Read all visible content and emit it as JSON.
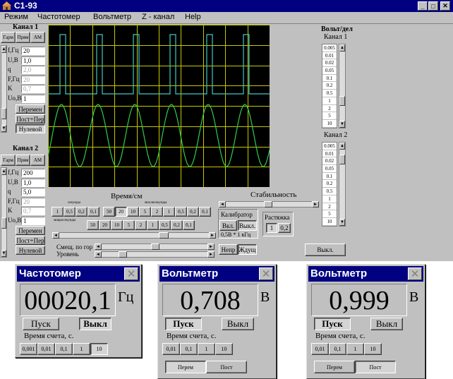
{
  "window": {
    "title": "С1-93"
  },
  "menu": [
    "Режим",
    "Частотомер",
    "Вольтметр",
    "Z - канал",
    "Help"
  ],
  "channel1": {
    "title": "Канал 1",
    "modes": [
      "Гарм",
      "Прям",
      "АМ"
    ],
    "rows": [
      {
        "label": "f,Гц",
        "value": "20",
        "dim": false
      },
      {
        "label": "U,B",
        "value": "1,0",
        "dim": false
      },
      {
        "label": "q",
        "value": "2,0",
        "dim": true
      },
      {
        "label": "F,Гц",
        "value": "20",
        "dim": true
      },
      {
        "label": "K",
        "value": "0,7",
        "dim": true
      },
      {
        "label": "Uo,B",
        "value": "1",
        "dim": false
      }
    ],
    "buttons": [
      "Перемен",
      "Пост+Пер",
      "Нулевой"
    ]
  },
  "channel2": {
    "title": "Канал 2",
    "modes": [
      "Гарм",
      "Прям",
      "АМ"
    ],
    "rows": [
      {
        "label": "f,Гц",
        "value": "200",
        "dim": false
      },
      {
        "label": "U,B",
        "value": "1,0",
        "dim": false
      },
      {
        "label": "q",
        "value": "5,0",
        "dim": false
      },
      {
        "label": "F,Гц",
        "value": "20",
        "dim": true
      },
      {
        "label": "K",
        "value": "0,7",
        "dim": true
      },
      {
        "label": "Uo,B",
        "value": "1",
        "dim": false
      }
    ],
    "buttons": [
      "Перемен",
      "Пост+Пер",
      "Нулевой"
    ]
  },
  "volts_per_div": {
    "title": "Вольт/дел",
    "ch1_label": "Канал 1",
    "ch2_label": "Канал 2",
    "values": [
      "0.005",
      "0.01",
      "0.02",
      "0.05",
      "0.1",
      "0.2",
      "0.5",
      "1",
      "2",
      "5",
      "10"
    ],
    "ch1_selected": 0.75,
    "ch2_selected": 0.08
  },
  "timebase": {
    "title": "Время/см",
    "seconds_label": "секунды",
    "millis_label": "миллисекунды",
    "micros_label": "микросекунды",
    "row1": [
      "1",
      "0,5",
      "0,2",
      "0,1"
    ],
    "row1b": [
      "50",
      "20",
      "10",
      "5",
      "2",
      "1",
      "0,5",
      "0,2",
      "0,1"
    ],
    "row2": [
      "50",
      "20",
      "10",
      "5",
      "2",
      "1",
      "0,5",
      "0,2",
      "0,1"
    ],
    "selected_row1b": "20"
  },
  "stability": {
    "title": "Стабильность",
    "level": 0.48
  },
  "calibrator": {
    "title": "Калибратор",
    "on": "Вкл.",
    "off": "Выкл.",
    "note": "0,5B * 1 кГц"
  },
  "stretch": {
    "title": "Растяжка",
    "options": [
      "1",
      "0,2"
    ]
  },
  "sweep": {
    "continuous": "Непр",
    "waiting": "Ждущ"
  },
  "offsets": {
    "horizontal_label": "Смещ. по гор",
    "level_label": "Уровень",
    "horizontal": 0.5,
    "level": 0.17
  },
  "power_off_button": "Выкл.",
  "frequency_meter": {
    "title": "Частотомер",
    "display": "00020,1",
    "unit": "Гц",
    "start": "Пуск",
    "off": "Выкл",
    "count_time_label": "Время счета, с.",
    "count_times": [
      "0,001",
      "0,01",
      "0,1",
      "1",
      "10"
    ],
    "selected": "10"
  },
  "voltmeter1": {
    "title": "Вольтметр",
    "display": "0,708",
    "unit": "В",
    "start": "Пуск",
    "off": "Выкл",
    "count_time_label": "Время счета, с.",
    "count_times": [
      "0,01",
      "0,1",
      "1",
      "10"
    ],
    "modes": [
      "Перем",
      "Пост"
    ],
    "selected_mode": "Перем"
  },
  "voltmeter2": {
    "title": "Вольтметр",
    "display": "0,999",
    "unit": "В",
    "start": "Пуск",
    "off": "Выкл",
    "count_time_label": "Время счета, с.",
    "count_times": [
      "0,01",
      "0,1",
      "1",
      "10"
    ],
    "modes": [
      "Перем",
      "Пост"
    ],
    "selected_mode": "Пост"
  },
  "colors": {
    "title_bar": "#000080",
    "panel": "#c0c0c0",
    "scope_bg": "#000000",
    "scope_grid": "#c8c800",
    "trace_square": "#40c8c0",
    "trace_sine": "#30d040"
  },
  "scope_signals": {
    "ch1": {
      "shape": "square",
      "frequency_hz": 20
    },
    "ch2": {
      "shape": "sine",
      "frequency_hz": 200
    }
  }
}
